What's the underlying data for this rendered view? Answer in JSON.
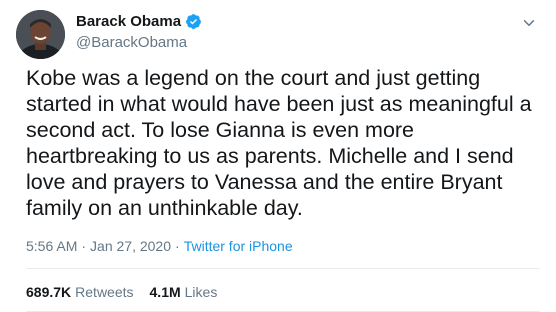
{
  "author": {
    "name": "Barack Obama",
    "handle": "@BarackObama",
    "verified_color": "#1da1f2"
  },
  "tweet": {
    "text": "Kobe was a legend on the court and just getting started in what would have been just as meaningful a second act. To lose Gianna is even more heartbreaking to us as parents. Michelle and I send love and prayers to Vanessa and the entire Bryant family on an unthinkable day.",
    "time": "5:56 AM",
    "separator": "·",
    "date": "Jan 27, 2020",
    "source": "Twitter for iPhone"
  },
  "stats": {
    "retweets_count": "689.7K",
    "retweets_label": "Retweets",
    "likes_count": "4.1M",
    "likes_label": "Likes"
  },
  "icons": {
    "verified": "verified-badge-icon",
    "menu": "chevron-down-icon"
  }
}
